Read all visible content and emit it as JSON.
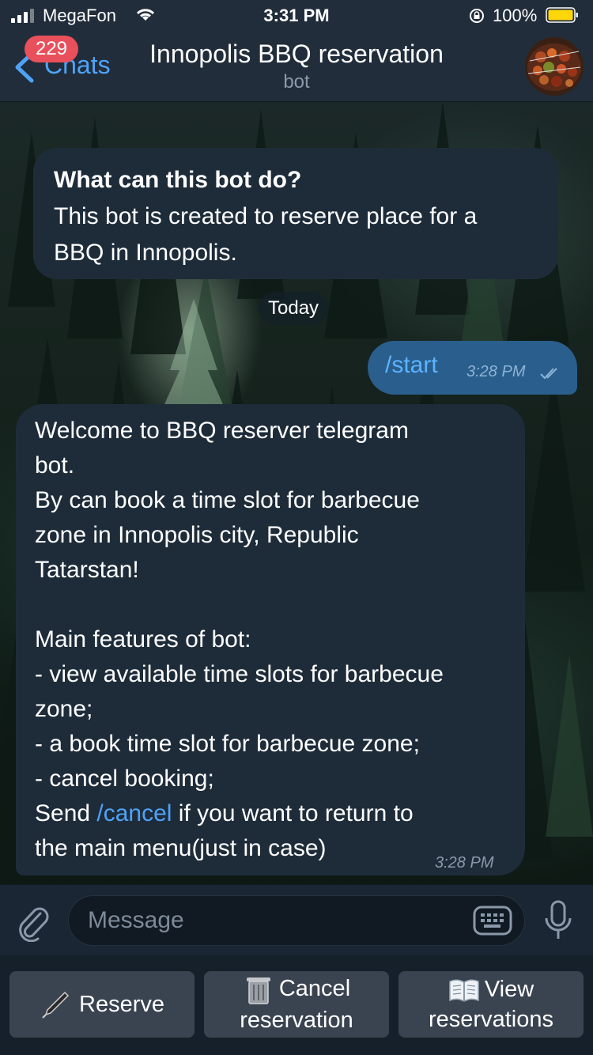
{
  "status_bar": {
    "carrier": "MegaFon",
    "time": "3:31 PM",
    "battery_percent": "100%"
  },
  "header": {
    "back_label": "Chats",
    "unread_badge": "229",
    "title": "Innopolis BBQ reservation",
    "subtitle": "bot"
  },
  "messages": {
    "info": {
      "title": "What can this bot do?",
      "lines": [
        "This bot is created to reserve place for a",
        "BBQ in Innopolis."
      ]
    },
    "date_separator": "Today",
    "outgoing": {
      "text": "/start",
      "time": "3:28 PM"
    },
    "incoming": {
      "lines": [
        "Welcome to BBQ reserver telegram",
        "bot.",
        "By can book a time slot for barbecue",
        "zone in Innopolis city, Republic",
        "Tatarstan!",
        "",
        "Main features of bot:",
        "- view available time slots for barbecue",
        "zone;",
        "- a book time slot for barbecue zone;",
        "- cancel booking;"
      ],
      "send_prefix": "Send ",
      "send_command": "/cancel",
      "send_suffix": " if you want to return to",
      "last_line": "the main menu(just in case)",
      "time": "3:28 PM"
    }
  },
  "input": {
    "placeholder": "Message"
  },
  "keyboard": {
    "reserve": "Reserve",
    "cancel_line1": "Cancel",
    "cancel_line2": "reservation",
    "view_line1": "View",
    "view_line2": "reservations"
  },
  "colors": {
    "accent": "#4fa3f7",
    "badge": "#e8505b",
    "bubble_in": "#1e2c3a",
    "bubble_out": "#2a5e8c"
  }
}
